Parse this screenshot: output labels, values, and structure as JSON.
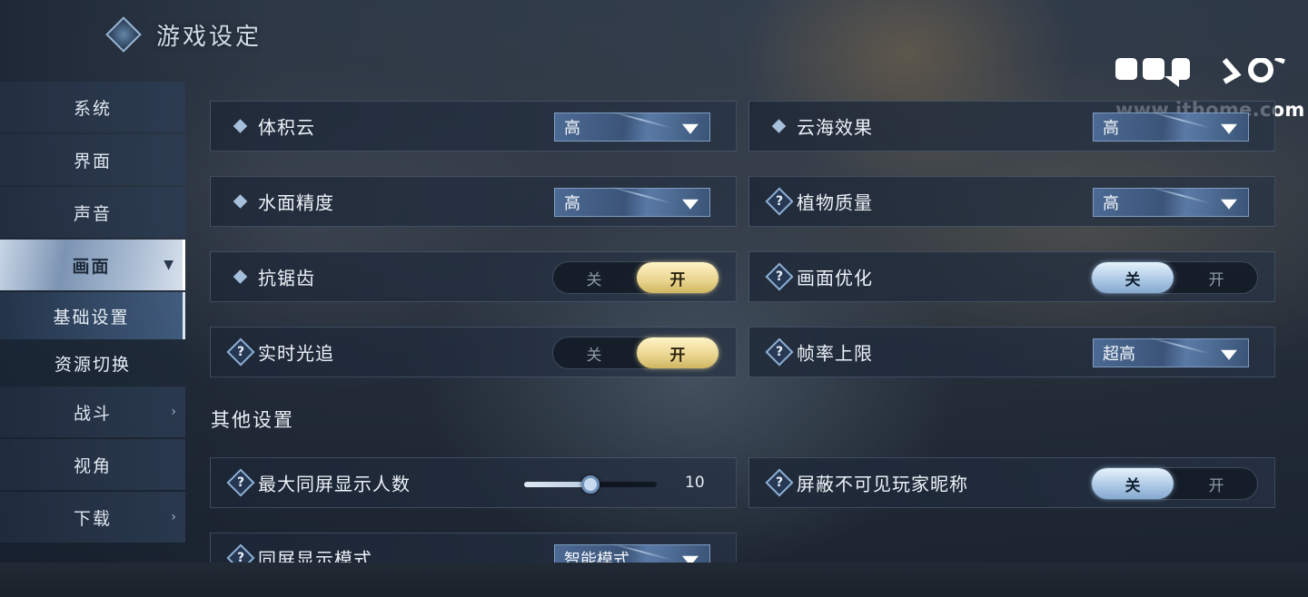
{
  "header": {
    "title": "游戏设定"
  },
  "watermark": {
    "text": "www.ithome.com"
  },
  "sidebar": {
    "items": [
      {
        "label": "系统"
      },
      {
        "label": "界面"
      },
      {
        "label": "声音"
      },
      {
        "label": "画面",
        "expanded": true
      },
      {
        "label": "战斗"
      },
      {
        "label": "视角"
      },
      {
        "label": "下载"
      }
    ],
    "subitems": [
      {
        "label": "基础设置",
        "selected": true
      },
      {
        "label": "资源切换"
      }
    ],
    "chevron_right": "›",
    "chevron_down": "⌄"
  },
  "settings": {
    "volumetric_clouds": {
      "label": "体积云",
      "value": "高",
      "icon": "diamond-bullet"
    },
    "cloud_sea": {
      "label": "云海效果",
      "value": "高",
      "icon": "diamond-bullet"
    },
    "water_quality": {
      "label": "水面精度",
      "value": "高",
      "icon": "diamond-bullet"
    },
    "plant_quality": {
      "label": "植物质量",
      "value": "高",
      "icon": "help-icon"
    },
    "antialiasing": {
      "label": "抗锯齿",
      "off": "关",
      "on": "开",
      "state": "on",
      "icon": "diamond-bullet"
    },
    "image_optimization": {
      "label": "画面优化",
      "off": "关",
      "on": "开",
      "state": "off",
      "icon": "help-icon"
    },
    "ray_tracing": {
      "label": "实时光追",
      "off": "关",
      "on": "开",
      "state": "on",
      "icon": "help-icon"
    },
    "frame_limit": {
      "label": "帧率上限",
      "value": "超高",
      "icon": "help-icon"
    }
  },
  "other_settings": {
    "title": "其他设置",
    "max_players": {
      "label": "最大同屏显示人数",
      "value": "10",
      "fraction": 0.5,
      "icon": "help-icon"
    },
    "hide_nicknames": {
      "label": "屏蔽不可见玩家昵称",
      "off": "关",
      "on": "开",
      "state": "off",
      "icon": "help-icon"
    },
    "display_mode": {
      "label": "同屏显示模式",
      "value": "智能模式",
      "icon": "help-icon"
    }
  },
  "help_glyph": "?",
  "colors": {
    "gold_toggle": "#e9d48e",
    "blue_toggle": "#a9c6e4",
    "dropdown": "#4c6a94"
  }
}
